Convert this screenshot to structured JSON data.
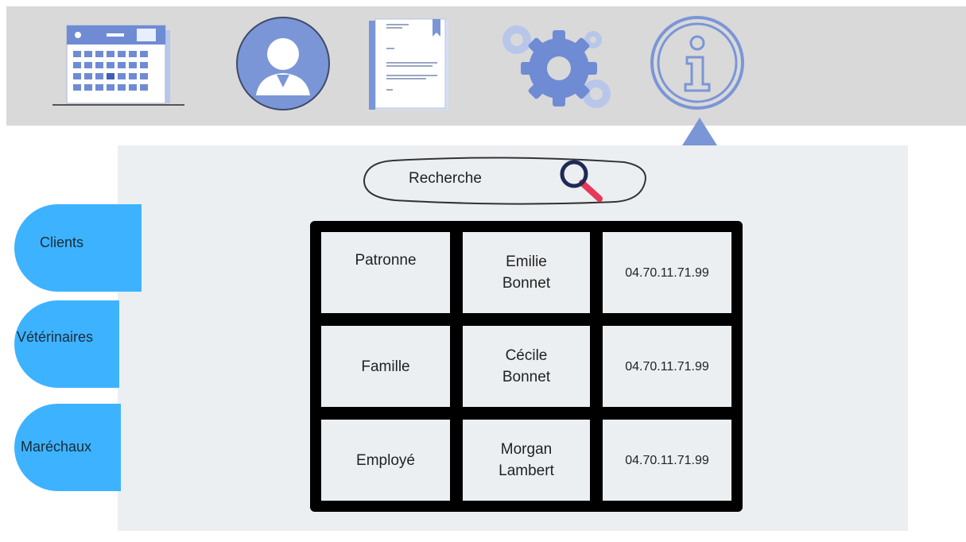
{
  "topbar": {
    "icons": [
      "calendar-icon",
      "user-profile-icon",
      "document-icon",
      "settings-gears-icon",
      "info-icon"
    ],
    "colors": {
      "accent": "#7b96d6",
      "bar": "#d9d9d9"
    }
  },
  "search": {
    "label": "Recherche",
    "icon": "magnifier-icon"
  },
  "sidebar": {
    "items": [
      {
        "label": "Clients"
      },
      {
        "label": "Vétérinaires"
      },
      {
        "label": "Maréchaux"
      }
    ],
    "color": "#3db3ff"
  },
  "table": {
    "rows": [
      {
        "role": "Patronne",
        "name_first": "Emilie",
        "name_last": "Bonnet",
        "phone": "04.70.11.71.99"
      },
      {
        "role": "Famille",
        "name_first": "Cécile",
        "name_last": "Bonnet",
        "phone": "04.70.11.71.99"
      },
      {
        "role": "Employé",
        "name_first": "Morgan",
        "name_last": "Lambert",
        "phone": "04.70.11.71.99"
      }
    ]
  }
}
